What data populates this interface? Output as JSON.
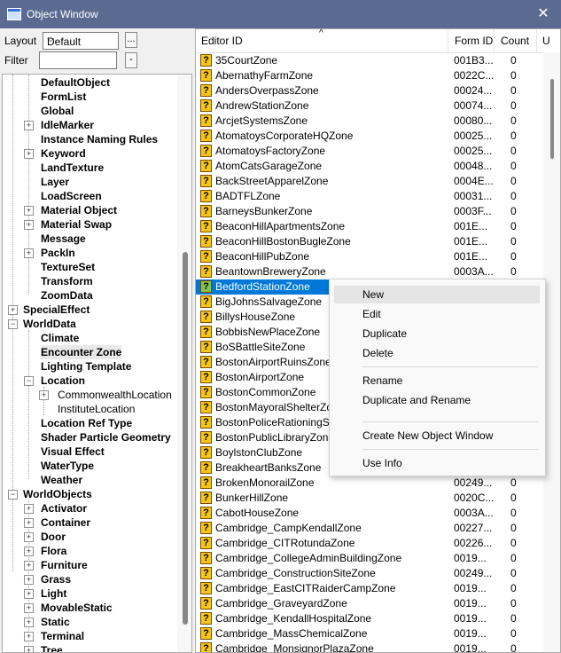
{
  "window": {
    "title": "Object Window",
    "close_glyph": "✕"
  },
  "toolbar": {
    "layout_label": "Layout",
    "layout_value": "Default",
    "layout_more": "...",
    "filter_label": "Filter",
    "filter_value": "",
    "filter_more": "-"
  },
  "tree": {
    "items": [
      {
        "label": "DefaultObject",
        "expandable": false
      },
      {
        "label": "FormList",
        "expandable": false
      },
      {
        "label": "Global",
        "expandable": false
      },
      {
        "label": "IdleMarker",
        "expandable": true
      },
      {
        "label": "Instance Naming Rules",
        "expandable": false
      },
      {
        "label": "Keyword",
        "expandable": true
      },
      {
        "label": "LandTexture",
        "expandable": false
      },
      {
        "label": "Layer",
        "expandable": false
      },
      {
        "label": "LoadScreen",
        "expandable": false
      },
      {
        "label": "Material Object",
        "expandable": true
      },
      {
        "label": "Material Swap",
        "expandable": true
      },
      {
        "label": "Message",
        "expandable": false
      },
      {
        "label": "PackIn",
        "expandable": true
      },
      {
        "label": "TextureSet",
        "expandable": false
      },
      {
        "label": "Transform",
        "expandable": false
      },
      {
        "label": "ZoomData",
        "expandable": false
      },
      {
        "label": "SpecialEffect",
        "expandable": true
      },
      {
        "label": "WorldData",
        "expandable": true
      },
      {
        "label": "Climate",
        "expandable": false
      },
      {
        "label": "Encounter Zone",
        "expandable": false
      },
      {
        "label": "Lighting Template",
        "expandable": false
      },
      {
        "label": "Location",
        "expandable": true
      },
      {
        "label": "CommonwealthLocation",
        "expandable": true
      },
      {
        "label": "InstituteLocation",
        "expandable": false
      },
      {
        "label": "Location Ref Type",
        "expandable": false
      },
      {
        "label": "Shader Particle Geometry",
        "expandable": false
      },
      {
        "label": "Visual Effect",
        "expandable": false
      },
      {
        "label": "WaterType",
        "expandable": false
      },
      {
        "label": "Weather",
        "expandable": false
      },
      {
        "label": "WorldObjects",
        "expandable": true
      },
      {
        "label": "Activator",
        "expandable": true
      },
      {
        "label": "Container",
        "expandable": true
      },
      {
        "label": "Door",
        "expandable": true
      },
      {
        "label": "Flora",
        "expandable": true
      },
      {
        "label": "Furniture",
        "expandable": true
      },
      {
        "label": "Grass",
        "expandable": true
      },
      {
        "label": "Light",
        "expandable": true
      },
      {
        "label": "MovableStatic",
        "expandable": true
      },
      {
        "label": "Static",
        "expandable": true
      },
      {
        "label": "Terminal",
        "expandable": true
      },
      {
        "label": "Tree",
        "expandable": true
      }
    ]
  },
  "list": {
    "columns": {
      "editor_id": "Editor ID",
      "form_id": "Form ID",
      "count": "Count",
      "extra": "U"
    },
    "sort_glyph": "^",
    "icon_glyph": "?",
    "rows": [
      {
        "editor_id": "35CourtZone",
        "form_id": "001B3...",
        "count": "0"
      },
      {
        "editor_id": "AbernathyFarmZone",
        "form_id": "0022C...",
        "count": "0"
      },
      {
        "editor_id": "AndersOverpassZone",
        "form_id": "00024...",
        "count": "0"
      },
      {
        "editor_id": "AndrewStationZone",
        "form_id": "00074...",
        "count": "0"
      },
      {
        "editor_id": "ArcjetSystemsZone",
        "form_id": "00080...",
        "count": "0"
      },
      {
        "editor_id": "AtomatoysCorporateHQZone",
        "form_id": "00025...",
        "count": "0"
      },
      {
        "editor_id": "AtomatoysFactoryZone",
        "form_id": "00025...",
        "count": "0"
      },
      {
        "editor_id": "AtomCatsGarageZone",
        "form_id": "00048...",
        "count": "0"
      },
      {
        "editor_id": "BackStreetApparelZone",
        "form_id": "0004E...",
        "count": "0"
      },
      {
        "editor_id": "BADTFLZone",
        "form_id": "00031...",
        "count": "0"
      },
      {
        "editor_id": "BarneysBunkerZone",
        "form_id": "0003F...",
        "count": "0"
      },
      {
        "editor_id": "BeaconHillApartmentsZone",
        "form_id": "001E...",
        "count": "0"
      },
      {
        "editor_id": "BeaconHillBostonBugleZone",
        "form_id": "001E...",
        "count": "0"
      },
      {
        "editor_id": "BeaconHillPubZone",
        "form_id": "001E...",
        "count": "0"
      },
      {
        "editor_id": "BeantownBreweryZone",
        "form_id": "0003A...",
        "count": "0"
      },
      {
        "editor_id": "BedfordStationZone",
        "form_id": "",
        "count": ""
      },
      {
        "editor_id": "BigJohnsSalvageZone",
        "form_id": "",
        "count": ""
      },
      {
        "editor_id": "BillysHouseZone",
        "form_id": "",
        "count": ""
      },
      {
        "editor_id": "BobbisNewPlaceZone",
        "form_id": "",
        "count": ""
      },
      {
        "editor_id": "BoSBattleSiteZone",
        "form_id": "",
        "count": ""
      },
      {
        "editor_id": "BostonAirportRuinsZone",
        "form_id": "",
        "count": ""
      },
      {
        "editor_id": "BostonAirportZone",
        "form_id": "",
        "count": ""
      },
      {
        "editor_id": "BostonCommonZone",
        "form_id": "",
        "count": ""
      },
      {
        "editor_id": "BostonMayoralShelterZone",
        "form_id": "",
        "count": ""
      },
      {
        "editor_id": "BostonPoliceRationingSiteZ",
        "form_id": "",
        "count": ""
      },
      {
        "editor_id": "BostonPublicLibraryZone",
        "form_id": "",
        "count": ""
      },
      {
        "editor_id": "BoylstonClubZone",
        "form_id": "",
        "count": ""
      },
      {
        "editor_id": "BreakheartBanksZone",
        "form_id": "",
        "count": ""
      },
      {
        "editor_id": "BrokenMonorailZone",
        "form_id": "00249...",
        "count": "0"
      },
      {
        "editor_id": "BunkerHillZone",
        "form_id": "0020C...",
        "count": "0"
      },
      {
        "editor_id": "CabotHouseZone",
        "form_id": "0003A...",
        "count": "0"
      },
      {
        "editor_id": "Cambridge_CampKendallZone",
        "form_id": "00227...",
        "count": "0"
      },
      {
        "editor_id": "Cambridge_CITRotundaZone",
        "form_id": "00226...",
        "count": "0"
      },
      {
        "editor_id": "Cambridge_CollegeAdminBuildingZone",
        "form_id": "0019...",
        "count": "0"
      },
      {
        "editor_id": "Cambridge_ConstructionSiteZone",
        "form_id": "00249...",
        "count": "0"
      },
      {
        "editor_id": "Cambridge_EastCITRaiderCampZone",
        "form_id": "0019...",
        "count": "0"
      },
      {
        "editor_id": "Cambridge_GraveyardZone",
        "form_id": "0019...",
        "count": "0"
      },
      {
        "editor_id": "Cambridge_KendallHospitalZone",
        "form_id": "0019...",
        "count": "0"
      },
      {
        "editor_id": "Cambridge_MassChemicalZone",
        "form_id": "0019...",
        "count": "0"
      },
      {
        "editor_id": "Cambridge_MonsignorPlazaZone",
        "form_id": "0019...",
        "count": "0"
      }
    ],
    "selected_index": 15
  },
  "context_menu": {
    "items": [
      "New",
      "Edit",
      "Duplicate",
      "Delete",
      "Rename",
      "Duplicate and Rename",
      "Create New Object Window",
      "Use Info"
    ],
    "highlighted_index": 0
  },
  "colors": {
    "titlebar": "#5a6a91",
    "selection": "#0078d7",
    "question_icon": "#f5c518"
  }
}
